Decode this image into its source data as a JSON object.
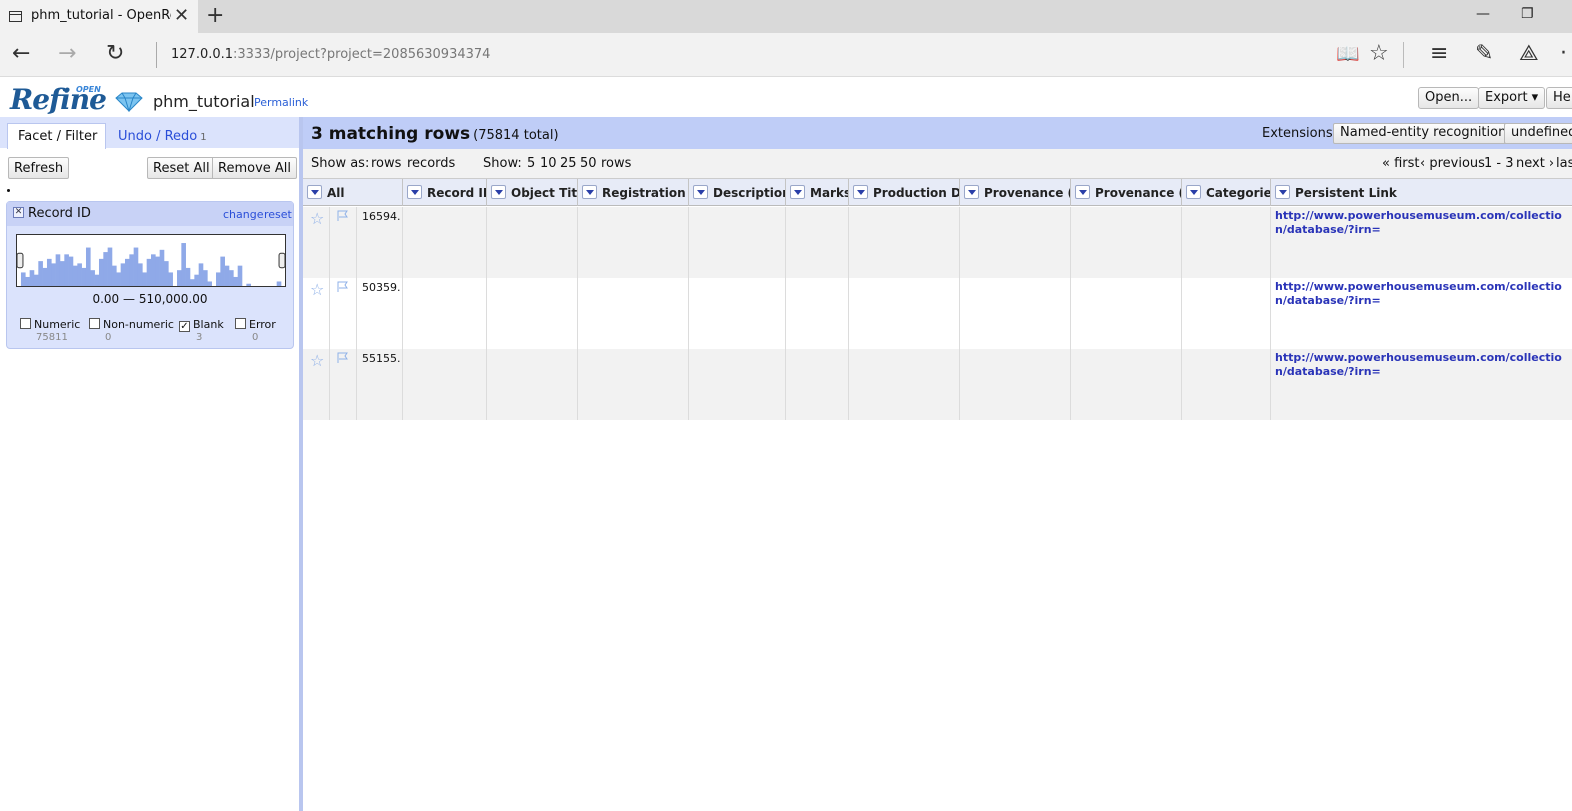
{
  "browser": {
    "tab_title": "phm_tutorial - OpenRefi",
    "url_host": "127.0.0.1",
    "url_rest": ":3333/project?project=2085630934374"
  },
  "header": {
    "logo_text": "Refine",
    "logo_open": "OPEN",
    "project_name": "phm_tutorial",
    "permalink": "Permalink",
    "open_button": "Open...",
    "export_button": "Export ▾",
    "help_button": "He"
  },
  "left_panel": {
    "tab_facet": "Facet / Filter",
    "tab_undo": "Undo / Redo",
    "undo_count": "1",
    "refresh_button": "Refresh",
    "reset_all_button": "Reset All",
    "remove_all_button": "Remove All",
    "facet": {
      "title": "Record ID",
      "change_link": "change",
      "reset_link": "reset",
      "range_text": "0.00 — 510,000.00",
      "histogram_bars": [
        0.3,
        0.2,
        0.35,
        0.25,
        0.55,
        0.4,
        0.6,
        0.5,
        0.7,
        0.55,
        0.7,
        0.65,
        0.45,
        0.5,
        0.4,
        0.85,
        0.35,
        0.25,
        0.6,
        0.75,
        0.85,
        0.45,
        0.3,
        0.5,
        0.6,
        0.7,
        0.85,
        0.5,
        0.3,
        0.6,
        0.7,
        0.65,
        0.8,
        0.55,
        0.3,
        0.0,
        0.35,
        0.95,
        0.4,
        0.15,
        0.25,
        0.5,
        0.35,
        0.1,
        0.0,
        0.3,
        0.65,
        0.45,
        0.35,
        0.2,
        0.45,
        0.0,
        0.05,
        0.0,
        0.0,
        0.0,
        0.0,
        0.0,
        0.0,
        0.1
      ],
      "choices": [
        {
          "label": "Numeric",
          "count": "75811",
          "checked": false
        },
        {
          "label": "Non-numeric",
          "count": "0",
          "checked": false
        },
        {
          "label": "Blank",
          "count": "3",
          "checked": true
        },
        {
          "label": "Error",
          "count": "0",
          "checked": false
        }
      ]
    }
  },
  "summary": {
    "matching": "3 matching rows",
    "total": "(75814 total)",
    "extensions_label": "Extensions:",
    "ner_button": "Named-entity recognition ▾",
    "undefined_button": "undefined"
  },
  "viewbar": {
    "show_as_label": "Show as:",
    "rows_mode": "rows",
    "records_mode": "records",
    "show_label": "Show:",
    "page_sizes": [
      "5",
      "10",
      "25"
    ],
    "current_size": "50",
    "rows_word": "rows",
    "first": "« first",
    "previous": "‹ previous",
    "range": "1 - 3",
    "next": "next ›",
    "last": "las"
  },
  "table": {
    "all_label": "All",
    "columns": [
      "Record ID",
      "Object Title",
      "Registration Nur",
      "Description.",
      "Marks",
      "Production Date",
      "Provenance (Prc",
      "Provenance (His",
      "Categories",
      "Persistent Link"
    ],
    "rows": [
      {
        "num": "16594.",
        "link": "http://www.powerhousemuseum.com/collection/database/?irn="
      },
      {
        "num": "50359.",
        "link": "http://www.powerhousemuseum.com/collection/database/?irn="
      },
      {
        "num": "55155.",
        "link": "http://www.powerhousemuseum.com/collection/database/?irn="
      }
    ]
  },
  "colors": {
    "accent_blue": "#2a4ed8",
    "panel_blue": "#dbe3fc",
    "summary_blue": "#bfcdf7",
    "histogram_bar": "#8fa9e8"
  }
}
